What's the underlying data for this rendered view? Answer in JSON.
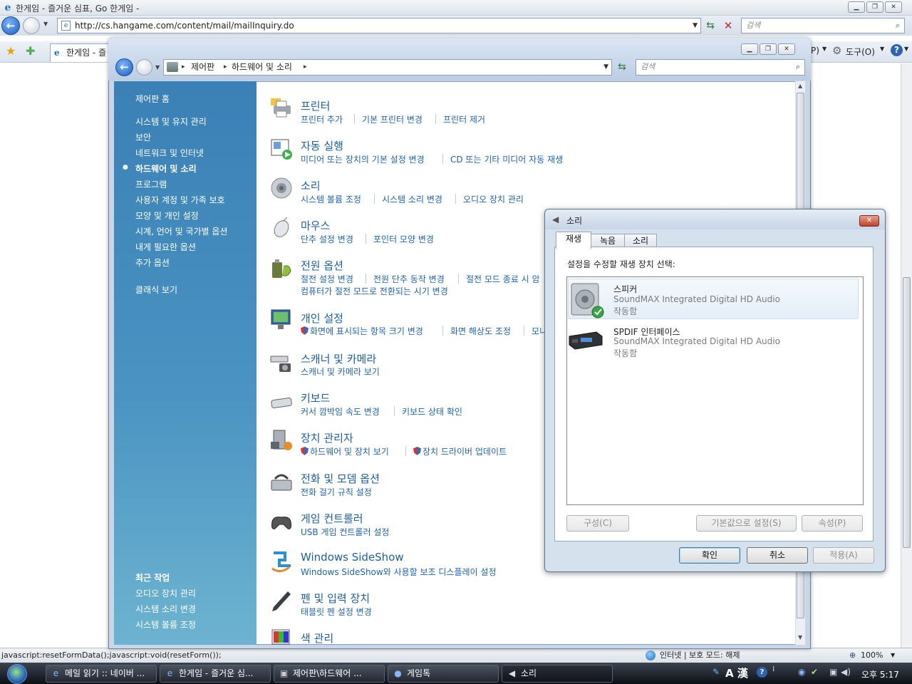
{
  "ie": {
    "title": "한게임 - 즐거운 심표, Go 한게임 -",
    "url": "http://cs.hangame.com/content/mail/mailInquiry.do",
    "search_placeholder": "검색",
    "tab_label": "한게임 - 즐",
    "right_menu": "P)",
    "tools_menu": "도구(O)",
    "status_text": "javascript:resetFormData();javascript:void(resetForm());",
    "zone": "인터넷 | 보호 모드: 해제",
    "zoom": "100%"
  },
  "cp": {
    "breadcrumb": [
      "제어판",
      "하드웨어 및 소리"
    ],
    "search_placeholder": "검색",
    "nav": {
      "home": "제어판 홈",
      "items": [
        "시스템 및 유지 관리",
        "보안",
        "네트워크 및 인터넷",
        "하드웨어 및 소리",
        "프로그램",
        "사용자 계정 및 가족 보호",
        "모양 및 개인 설정",
        "시계, 언어 및 국가별 옵션",
        "내게 필요한 옵션",
        "추가 옵션"
      ],
      "classic": "클래식 보기",
      "recent_title": "최근 작업",
      "recent": [
        "오디오 장치 관리",
        "시스템 소리 변경",
        "시스템 볼륨 조정"
      ]
    },
    "categories": [
      {
        "title": "프린터",
        "links": [
          "프린터 추가",
          "기본 프린터 변경",
          "프린터 제거"
        ]
      },
      {
        "title": "자동 실행",
        "links": [
          "미디어 또는 장치의 기본 설정 변경",
          "CD 또는 기타 미디어 자동 재생"
        ]
      },
      {
        "title": "소리",
        "links": [
          "시스템 볼륨 조정",
          "시스템 소리 변경",
          "오디오 장치 관리"
        ]
      },
      {
        "title": "마우스",
        "links": [
          "단추 설정 변경",
          "포인터 모양 변경"
        ]
      },
      {
        "title": "전원 옵션",
        "links": [
          "절전 설정 변경",
          "전원 단추 동작 변경",
          "절전 모드 종료 시 암",
          "컴퓨터가 절전 모드로 전환되는 시기 변경"
        ]
      },
      {
        "title": "개인 설정",
        "links": [
          "화면에 표시되는 항목 크기 변경",
          "화면 해상도 조정",
          "모니"
        ]
      },
      {
        "title": "스캐너 및 카메라",
        "links": [
          "스캐너 및 카메라 보기"
        ]
      },
      {
        "title": "키보드",
        "links": [
          "커서 깜박임 속도 변경",
          "키보드 상태 확인"
        ]
      },
      {
        "title": "장치 관리자",
        "links": [
          "하드웨어 및 장치 보기",
          "장치 드라이버 업데이트"
        ]
      },
      {
        "title": "전화 및 모뎀 옵션",
        "links": [
          "전화 걸기 규칙 설정"
        ]
      },
      {
        "title": "게임 컨트롤러",
        "links": [
          "USB 게임 컨트롤러 설정"
        ]
      },
      {
        "title": "Windows SideShow",
        "links": [
          "Windows SideShow와 사용할 보조 디스플레이 설정"
        ]
      },
      {
        "title": "펜 및 입력 장치",
        "links": [
          "태블릿 펜 설정 변경"
        ]
      },
      {
        "title": "색 관리",
        "links": []
      }
    ]
  },
  "sound": {
    "title": "소리",
    "tabs": [
      "재생",
      "녹음",
      "소리"
    ],
    "prompt": "설정을 수정할 재생 장치 선택:",
    "devices": [
      {
        "name": "스피커",
        "driver": "SoundMAX Integrated Digital HD Audio",
        "status": "작동함"
      },
      {
        "name": "SPDIF 인터페이스",
        "driver": "SoundMAX Integrated Digital HD Audio",
        "status": "작동함"
      }
    ],
    "buttons": {
      "configure": "구성(C)",
      "set_default": "기본값으로 설정(S)",
      "properties": "속성(P)",
      "ok": "확인",
      "cancel": "취소",
      "apply": "적용(A)"
    }
  },
  "taskbar": {
    "items": [
      "메일 읽기 :: 네이버 ...",
      "한게임 - 즐거운 심...",
      "제어판\\하드웨어 ...",
      "게임톡",
      "소리"
    ],
    "clock": "오후 5:17",
    "ime": "A 漢"
  }
}
